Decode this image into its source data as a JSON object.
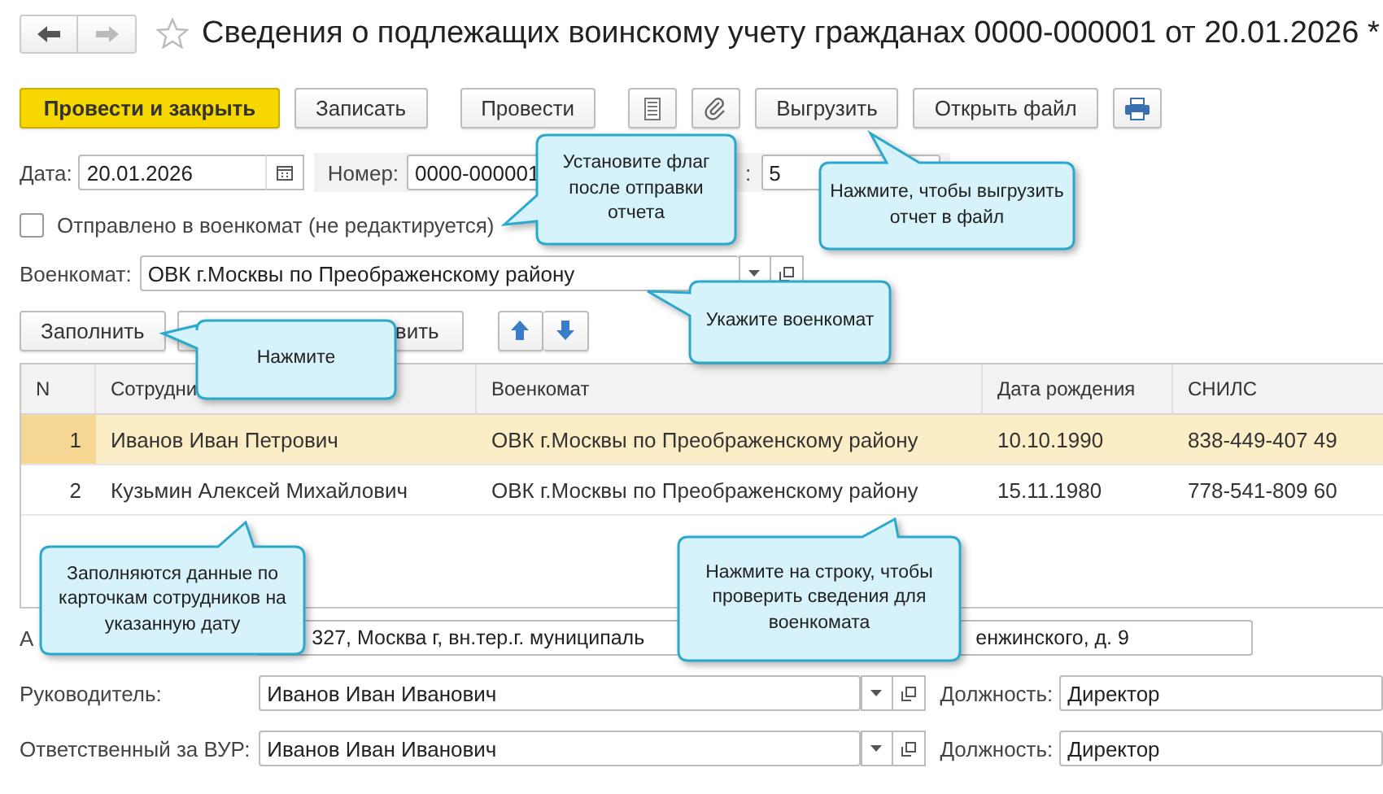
{
  "title": "Сведения о подлежащих воинскому учету гражданах 0000-000001 от 20.01.2026 *",
  "favorite": false,
  "toolbar": [
    {
      "label": "Провести и закрыть",
      "default": true
    },
    {
      "label": "Записать",
      "default": false
    },
    {
      "label": "Провести",
      "default": false
    },
    {
      "label": "Выгрузить",
      "default": false
    },
    {
      "label": "Открыть файл",
      "default": false
    }
  ],
  "date": {
    "label": "Дата:",
    "value": "20.01.2026"
  },
  "number": {
    "label": "Номер:",
    "value": "0000-000001"
  },
  "extra": {
    "label": ":",
    "value": "5"
  },
  "sent": {
    "label": "Отправлено в военкомат (не редактируется)",
    "checked": false
  },
  "voenkomat": {
    "label": "Военкомат:",
    "value": "ОВК г.Москвы по Преображенскому району"
  },
  "table_buttons": [
    "Заполнить",
    "вить"
  ],
  "table": {
    "columns": [
      "N",
      "Сотрудни",
      "Военкомат",
      "Дата рождения",
      "СНИЛС"
    ],
    "rows": [
      {
        "n": "1",
        "employee": "Иванов Иван Петрович",
        "voenkomat": "ОВК г.Москвы по Преображенскому району",
        "birth": "10.10.1990",
        "snils": "838-449-407 49",
        "selected": true
      },
      {
        "n": "2",
        "employee": "Кузьмин Алексей Михайлович",
        "voenkomat": "ОВК г.Москвы по Преображенскому району",
        "birth": "15.11.1980",
        "snils": "778-541-809 60",
        "selected": false
      }
    ]
  },
  "address": {
    "label": "А",
    "value_parts": [
      "327, Москва г, вн.тер.г. муниципаль",
      "енжинского, д. 9"
    ]
  },
  "signers": [
    {
      "label": "Руководитель:",
      "value": "Иванов Иван Иванович",
      "position_label": "Должность:",
      "position_value": "Директор"
    },
    {
      "label": "Ответственный за ВУР:",
      "value": "Иванов Иван Иванович",
      "position_label": "Должность:",
      "position_value": "Директор"
    }
  ],
  "callouts": [
    "Установите флаг после отправки отчета",
    "Нажмите, чтобы выгрузить отчет в файл",
    "Укажите военкомат",
    "Нажмите",
    "Заполняются данные по карточкам сотрудников на указанную дату",
    "Нажмите на строку, чтобы проверить сведения для военкомата"
  ]
}
